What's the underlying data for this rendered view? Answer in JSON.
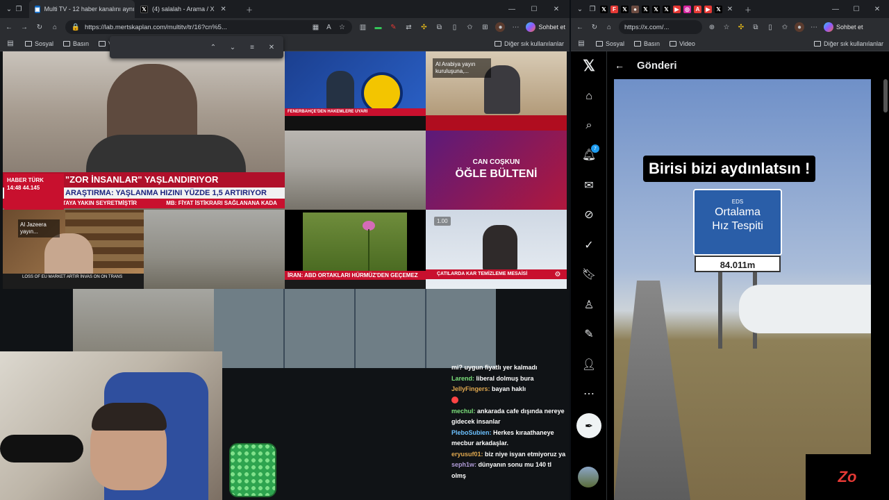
{
  "left_window": {
    "tabs": [
      {
        "label": "Multi TV - 12 haber kanalını aynı a",
        "active": true
      },
      {
        "label": "(4) salalah - Arama / X",
        "active": false
      }
    ],
    "url": "https://lab.mertskaplan.com/multitv/tr/16?cn%5...",
    "chat_button": "Sohbet et",
    "bookmarks": [
      "Sosyal",
      "Basın",
      "V"
    ],
    "bookmarks_other": "Diğer sık kullanılanlar",
    "tiles": {
      "t1_banner_top": "\"ZOR İNSANLAR\" YAŞLANDIRIYOR",
      "t1_banner_mid": "ARAŞTIRMA: YAŞLANMA HIZINI YÜZDE 1,5 ARTIRIYOR",
      "t1_banner_ticker": "TAYA YAKIN SEYRETMİŞTİR",
      "t1_banner_ticker2": "MB: FİYAT İSTİKRARI SAĞLANANA KADA",
      "t1_channel": "HABER TÜRK",
      "t1_time": "14:48",
      "t1_index": "44.145",
      "t2_ticker": "FENERBAHÇE'DEN HAKEMLERE UYARI",
      "t3_overlay": "Al Arabiya yayın kuruluşuna,...",
      "t6_brand": "CAN COŞKUN",
      "t6_title": "ÖĞLE BÜLTENİ",
      "t7_overlay": "Al Jazeera yayın...",
      "t7_ticker": "LOSS OF EU MARKET ARTIR İNVAS ON ON TRANS",
      "t9_banner": "İRAN: ABD ORTAKLARI HÜRMÜZ'DEN GEÇEMEZ",
      "t10_badge": "1.00",
      "t10_banner": "ÇATILARDA KAR TEMİZLEME MESAİSİ"
    },
    "chat": [
      {
        "user": "",
        "text": "mi? uygun fiyatlı yer kalmadı",
        "color": "#ffffff"
      },
      {
        "user": "Larend:",
        "text": "liberal dolmuş bura",
        "color": "#7be07b"
      },
      {
        "user": "JellyFingers:",
        "text": "bayan haklı",
        "color": "#e0a84f"
      },
      {
        "user": "",
        "text": "",
        "color": "#ff4444"
      },
      {
        "user": "mechul:",
        "text": "ankarada cafe dışında nereye gidecek insanlar",
        "color": "#7be07b"
      },
      {
        "user": "PleboSubien:",
        "text": "Herkes kıraathaneye mecbur arkadaşlar.",
        "color": "#6cc1ff"
      },
      {
        "user": "eryusuf01:",
        "text": "biz niye isyan etmiyoruz ya",
        "color": "#e0a84f"
      },
      {
        "user": "seph1w:",
        "text": "dünyanın sonu mu 140 tl olmş",
        "color": "#b19cd9"
      }
    ]
  },
  "right_window": {
    "url": "https://x.com/...",
    "chat_button": "Sohbet et",
    "bookmarks": [
      "Sosyal",
      "Basın",
      "Video"
    ],
    "bookmarks_other": "Diğer sık kullanılanlar",
    "header_title": "Gönderi",
    "notification_count": "7",
    "video_caption": "Birisi bizi aydınlatsın !",
    "sign_line1": "Ortalama",
    "sign_line2": "Hız Tespiti",
    "sign_eds": "EDS",
    "sign_distance": "84.011m",
    "watermark": "Zo"
  }
}
